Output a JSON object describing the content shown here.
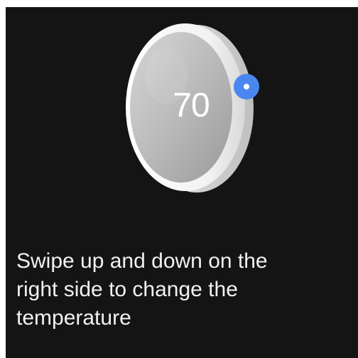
{
  "thermostat": {
    "temperature": "70",
    "ring_color": "#eaeaea",
    "face_color": "#b9b9b9",
    "indicator_color": "#4a86f0"
  },
  "instruction": {
    "text": "Swipe up and down on the\nright side to change the\ntemperature"
  },
  "theme": {
    "background": "#141414",
    "text_color": "#f1f1f1"
  }
}
